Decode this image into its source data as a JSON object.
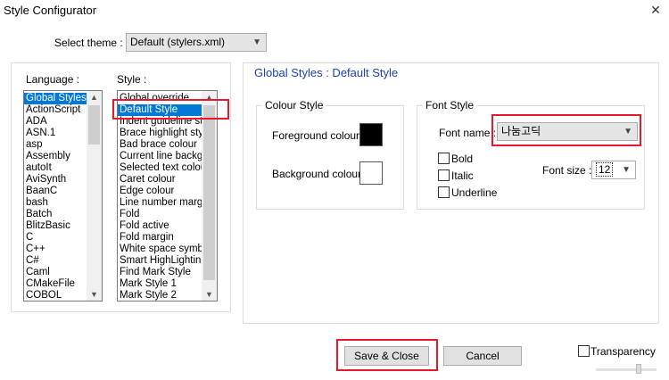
{
  "window": {
    "title": "Style Configurator",
    "close_glyph": "✕"
  },
  "theme": {
    "label": "Select theme :",
    "value": "Default (stylers.xml)"
  },
  "language": {
    "label": "Language :",
    "items": [
      "Global Styles",
      "ActionScript",
      "ADA",
      "ASN.1",
      "asp",
      "Assembly",
      "autoIt",
      "AviSynth",
      "BaanC",
      "bash",
      "Batch",
      "BlitzBasic",
      "C",
      "C++",
      "C#",
      "Caml",
      "CMakeFile",
      "COBOL"
    ],
    "selected": "Global Styles"
  },
  "style": {
    "label": "Style :",
    "items": [
      "Global override",
      "Default Style",
      "Indent guideline style",
      "Brace highlight style",
      "Bad brace colour",
      "Current line background colour",
      "Selected text colour",
      "Caret colour",
      "Edge colour",
      "Line number margin",
      "Fold",
      "Fold active",
      "Fold margin",
      "White space symbol",
      "Smart HighLighting",
      "Find Mark Style",
      "Mark Style 1",
      "Mark Style 2"
    ],
    "selected": "Default Style"
  },
  "panel": {
    "heading": "Global Styles : Default Style"
  },
  "colour_style": {
    "legend": "Colour Style",
    "foreground_label": "Foreground colour",
    "background_label": "Background colour",
    "foreground_color": "#000000",
    "background_color": "#ffffff"
  },
  "font_style": {
    "legend": "Font Style",
    "font_name_label": "Font name :",
    "font_name_value": "나눔고딕",
    "bold_label": "Bold",
    "italic_label": "Italic",
    "underline_label": "Underline",
    "font_size_label": "Font size :",
    "font_size_value": "12"
  },
  "buttons": {
    "save_close": "Save & Close",
    "cancel": "Cancel"
  },
  "transparency": {
    "label": "Transparency"
  },
  "colors": {
    "selection": "#0078d7",
    "highlight_box": "#e8192c",
    "heading_blue": "#1c3fb4"
  }
}
